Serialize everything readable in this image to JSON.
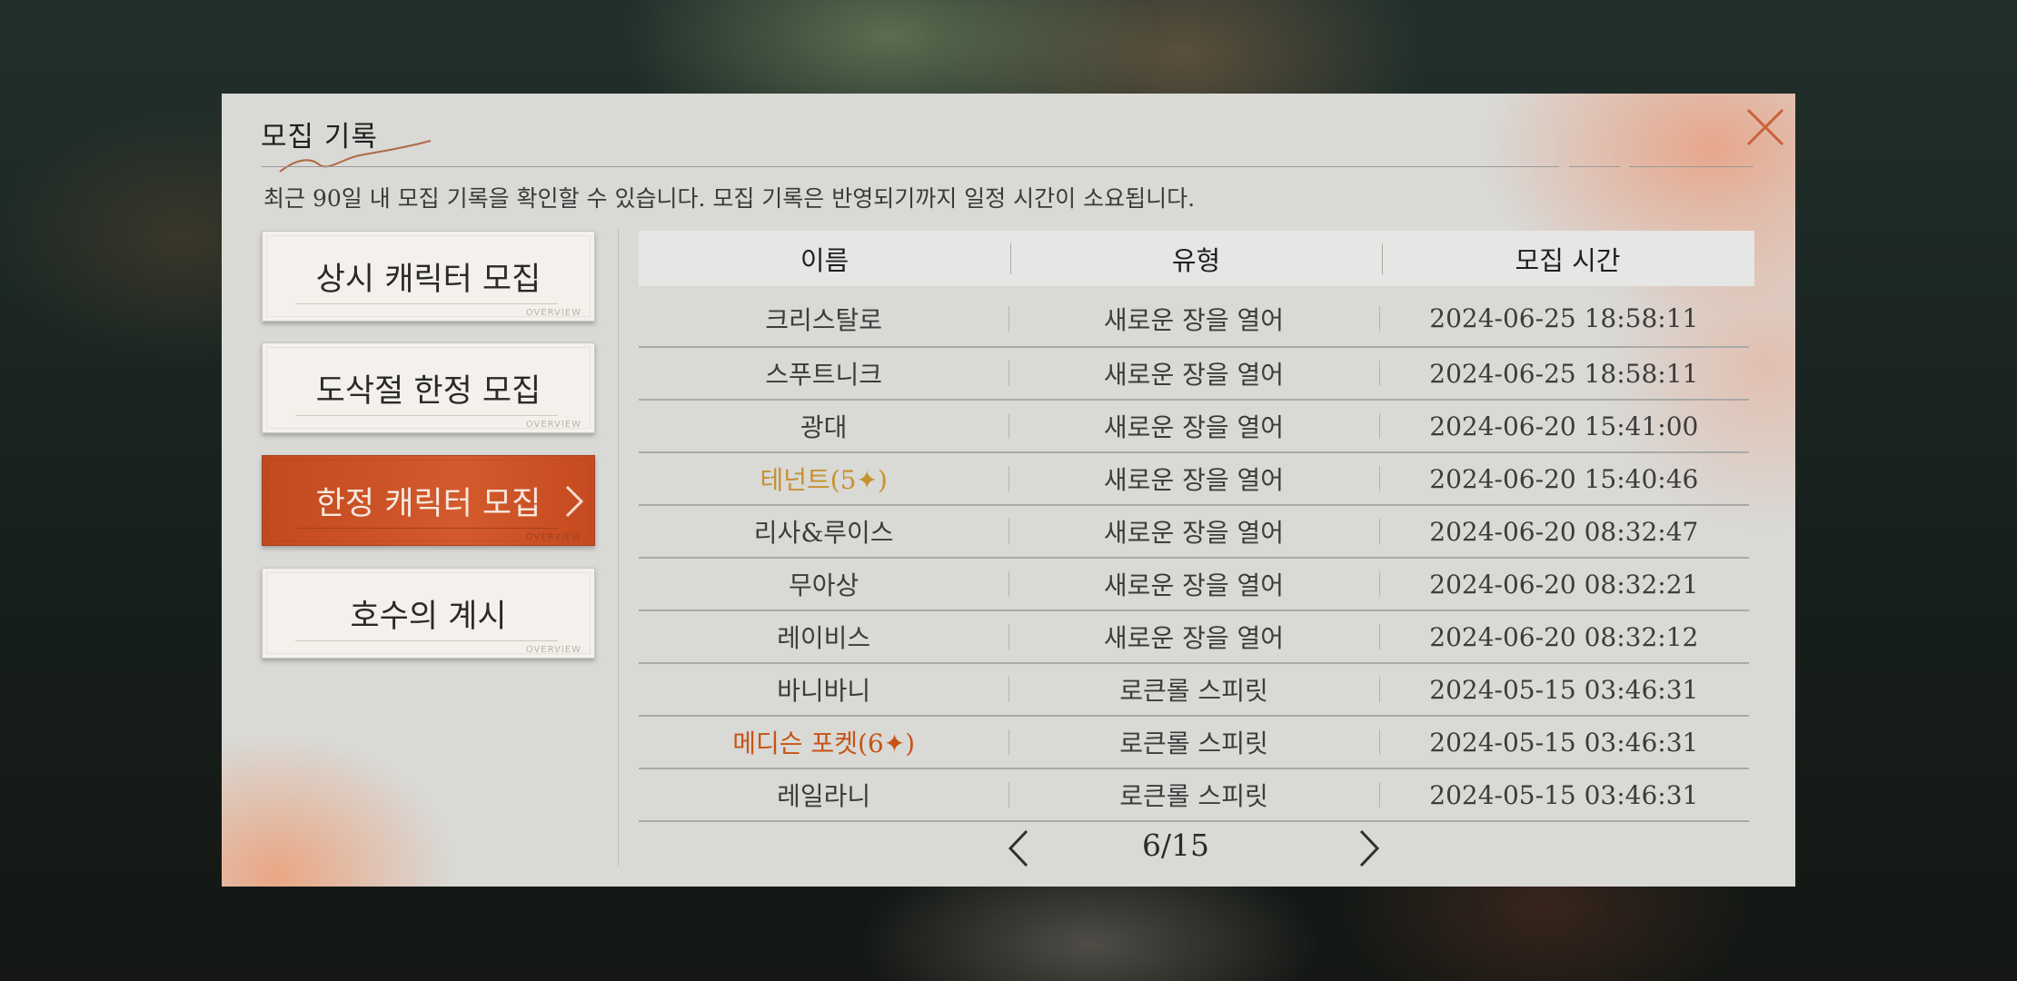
{
  "dialog": {
    "title": "모집 기록",
    "description": "최근 90일 내 모집 기록을 확인할 수 있습니다. 모집 기록은 반영되기까지 일정 시간이 소요됩니다.",
    "close_icon": "close-icon"
  },
  "categories": [
    {
      "label": "상시 캐릭터 모집",
      "tag": "OVERVIEW",
      "active": false
    },
    {
      "label": "도삭절 한정 모집",
      "tag": "OVERVIEW",
      "active": false
    },
    {
      "label": "한정 캐릭터 모집",
      "tag": "OVERVIEW",
      "active": true
    },
    {
      "label": "호수의 계시",
      "tag": "OVERVIEW",
      "active": false
    }
  ],
  "table": {
    "headers": [
      "이름",
      "유형",
      "모집 시간"
    ],
    "rows": [
      {
        "name": "크리스탈로",
        "type": "새로운 장을 열어",
        "time": "2024-06-25 18:58:11",
        "rarity": ""
      },
      {
        "name": "스푸트니크",
        "type": "새로운 장을 열어",
        "time": "2024-06-25 18:58:11",
        "rarity": ""
      },
      {
        "name": "광대",
        "type": "새로운 장을 열어",
        "time": "2024-06-20 15:41:00",
        "rarity": ""
      },
      {
        "name": "테넌트(5✦)",
        "type": "새로운 장을 열어",
        "time": "2024-06-20 15:40:46",
        "rarity": "gold"
      },
      {
        "name": "리사&루이스",
        "type": "새로운 장을 열어",
        "time": "2024-06-20 08:32:47",
        "rarity": ""
      },
      {
        "name": "무아상",
        "type": "새로운 장을 열어",
        "time": "2024-06-20 08:32:21",
        "rarity": ""
      },
      {
        "name": "레이비스",
        "type": "새로운 장을 열어",
        "time": "2024-06-20 08:32:12",
        "rarity": ""
      },
      {
        "name": "바니바니",
        "type": "로큰롤 스피릿",
        "time": "2024-05-15 03:46:31",
        "rarity": ""
      },
      {
        "name": "메디슨 포켓(6✦)",
        "type": "로큰롤 스피릿",
        "time": "2024-05-15 03:46:31",
        "rarity": "orange"
      },
      {
        "name": "레일라니",
        "type": "로큰롤 스피릿",
        "time": "2024-05-15 03:46:31",
        "rarity": ""
      }
    ]
  },
  "pagination": {
    "current": "6/15",
    "prev_icon": "chevron-left-icon",
    "next_icon": "chevron-right-icon"
  },
  "colors": {
    "accent": "#c94f22",
    "gold": "#c7912f",
    "orange": "#c75416",
    "panel": "#d9d9d6"
  }
}
